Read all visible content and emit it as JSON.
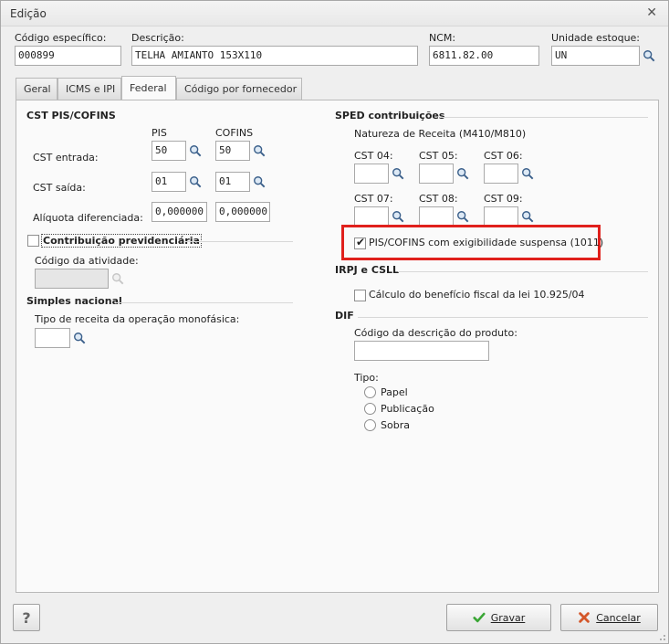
{
  "window": {
    "title": "Edição",
    "close_glyph": "✕"
  },
  "header": {
    "codigo_label": "Código específico:",
    "codigo_value": "000899",
    "descricao_label": "Descrição:",
    "descricao_value": "TELHA AMIANTO 153X110",
    "ncm_label": "NCM:",
    "ncm_value": "6811.82.00",
    "unidade_label": "Unidade estoque:",
    "unidade_value": "UN"
  },
  "tabs": [
    {
      "label": "Geral",
      "active": false
    },
    {
      "label": "ICMS e IPI",
      "active": false
    },
    {
      "label": "Federal",
      "active": true
    },
    {
      "label": "Código por fornecedor",
      "active": false
    }
  ],
  "cst": {
    "title": "CST PIS/COFINS",
    "pis_header": "PIS",
    "cofins_header": "COFINS",
    "entrada_label": "CST entrada:",
    "saida_label": "CST saída:",
    "aliquota_label": "Alíquota diferenciada:",
    "entrada_pis": "50",
    "entrada_cofins": "50",
    "saida_pis": "01",
    "saida_cofins": "01",
    "aliquota_pis": "0,000000",
    "aliquota_cofins": "0,000000"
  },
  "previdenciaria": {
    "label": "Contribuição previdenciária",
    "checked": false,
    "atividade_label": "Código da atividade:",
    "atividade_value": ""
  },
  "simples": {
    "title": "Simples nacional",
    "tipo_label": "Tipo de receita da operação monofásica:",
    "tipo_value": ""
  },
  "sped": {
    "title": "SPED contribuições",
    "natureza_label": "Natureza de Receita (M410/M810)",
    "cst04_label": "CST 04:",
    "cst05_label": "CST 05:",
    "cst06_label": "CST 06:",
    "cst07_label": "CST 07:",
    "cst08_label": "CST 08:",
    "cst09_label": "CST 09:",
    "exigibilidade_label": "PIS/COFINS com exigibilidade suspensa (1011)",
    "exigibilidade_checked": true,
    "highlight_color": "#e0201c"
  },
  "irpj": {
    "title": "IRPJ e CSLL",
    "beneficio_label": "Cálculo do benefício fiscal da lei 10.925/04",
    "beneficio_checked": false
  },
  "dif": {
    "title": "DIF",
    "codigo_label": "Código da descrição do produto:",
    "codigo_value": "",
    "tipo_label": "Tipo:",
    "options": [
      "Papel",
      "Publicação",
      "Sobra"
    ]
  },
  "footer": {
    "help_label": "?",
    "gravar_label": "Gravar",
    "cancelar_label": "Cancelar",
    "gravar_icon_color": "#3aa635",
    "cancelar_icon_color": "#d4572a"
  },
  "icons": {
    "lookup": "magnifier-icon",
    "gravar": "check-icon",
    "cancelar": "x-icon",
    "help": "question-icon"
  }
}
